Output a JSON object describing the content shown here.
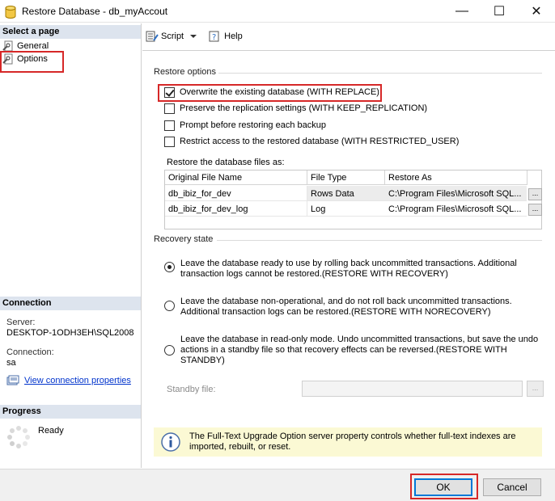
{
  "window": {
    "title": "Restore Database - db_myAccout",
    "minimize": "—",
    "maximize": "☐",
    "close": "✕"
  },
  "left": {
    "select_page_header": "Select a page",
    "pages": [
      {
        "label": "General",
        "icon": "wrench-page-icon"
      },
      {
        "label": "Options",
        "icon": "wrench-page-icon",
        "selected": true
      }
    ],
    "connection_header": "Connection",
    "server_label": "Server:",
    "server_value": "DESKTOP-1ODH3EH\\SQL2008",
    "connection_label": "Connection:",
    "connection_value": "sa",
    "view_connection_link": "View connection properties",
    "progress_header": "Progress",
    "progress_status": "Ready"
  },
  "toolbar": {
    "script_label": "Script",
    "help_label": "Help"
  },
  "restore_options": {
    "title": "Restore options",
    "checkboxes": [
      {
        "label": "Overwrite the existing database (WITH REPLACE)",
        "checked": true
      },
      {
        "label": "Preserve the replication settings (WITH KEEP_REPLICATION)",
        "checked": false
      },
      {
        "label": "Prompt before restoring each backup",
        "checked": false
      },
      {
        "label": "Restrict access to the restored database (WITH RESTRICTED_USER)",
        "checked": false
      }
    ],
    "files_label": "Restore the database files as:",
    "columns": [
      "Original File Name",
      "File Type",
      "Restore As"
    ],
    "rows": [
      {
        "original": "db_ibiz_for_dev",
        "type": "Rows Data",
        "restore_as": "C:\\Program Files\\Microsoft SQL...",
        "button": "..."
      },
      {
        "original": "db_ibiz_for_dev_log",
        "type": "Log",
        "restore_as": "C:\\Program Files\\Microsoft SQL...",
        "button": "..."
      }
    ]
  },
  "recovery": {
    "title": "Recovery state",
    "options": [
      {
        "text": "Leave the database ready to use by rolling back uncommitted transactions. Additional transaction logs cannot be restored.(RESTORE WITH RECOVERY)",
        "selected": true
      },
      {
        "text": "Leave the database non-operational, and do not roll back uncommitted transactions. Additional transaction logs can be restored.(RESTORE WITH NORECOVERY)",
        "selected": false
      },
      {
        "text": "Leave the database in read-only mode. Undo uncommitted transactions, but save the undo actions in a standby file so that recovery effects can be reversed.(RESTORE WITH STANDBY)",
        "selected": false
      }
    ],
    "standby_label": "Standby file:",
    "standby_value": "",
    "standby_button": "..."
  },
  "info": {
    "message": "The Full-Text Upgrade Option server property controls whether full-text indexes are imported, rebuilt, or reset."
  },
  "buttons": {
    "ok": "OK",
    "cancel": "Cancel"
  },
  "colors": {
    "highlight_red": "#d62828",
    "section_header": "#dde4ee",
    "link": "#0033cc",
    "info_bg": "#fbf9d4",
    "primary_border": "#0078d7"
  }
}
